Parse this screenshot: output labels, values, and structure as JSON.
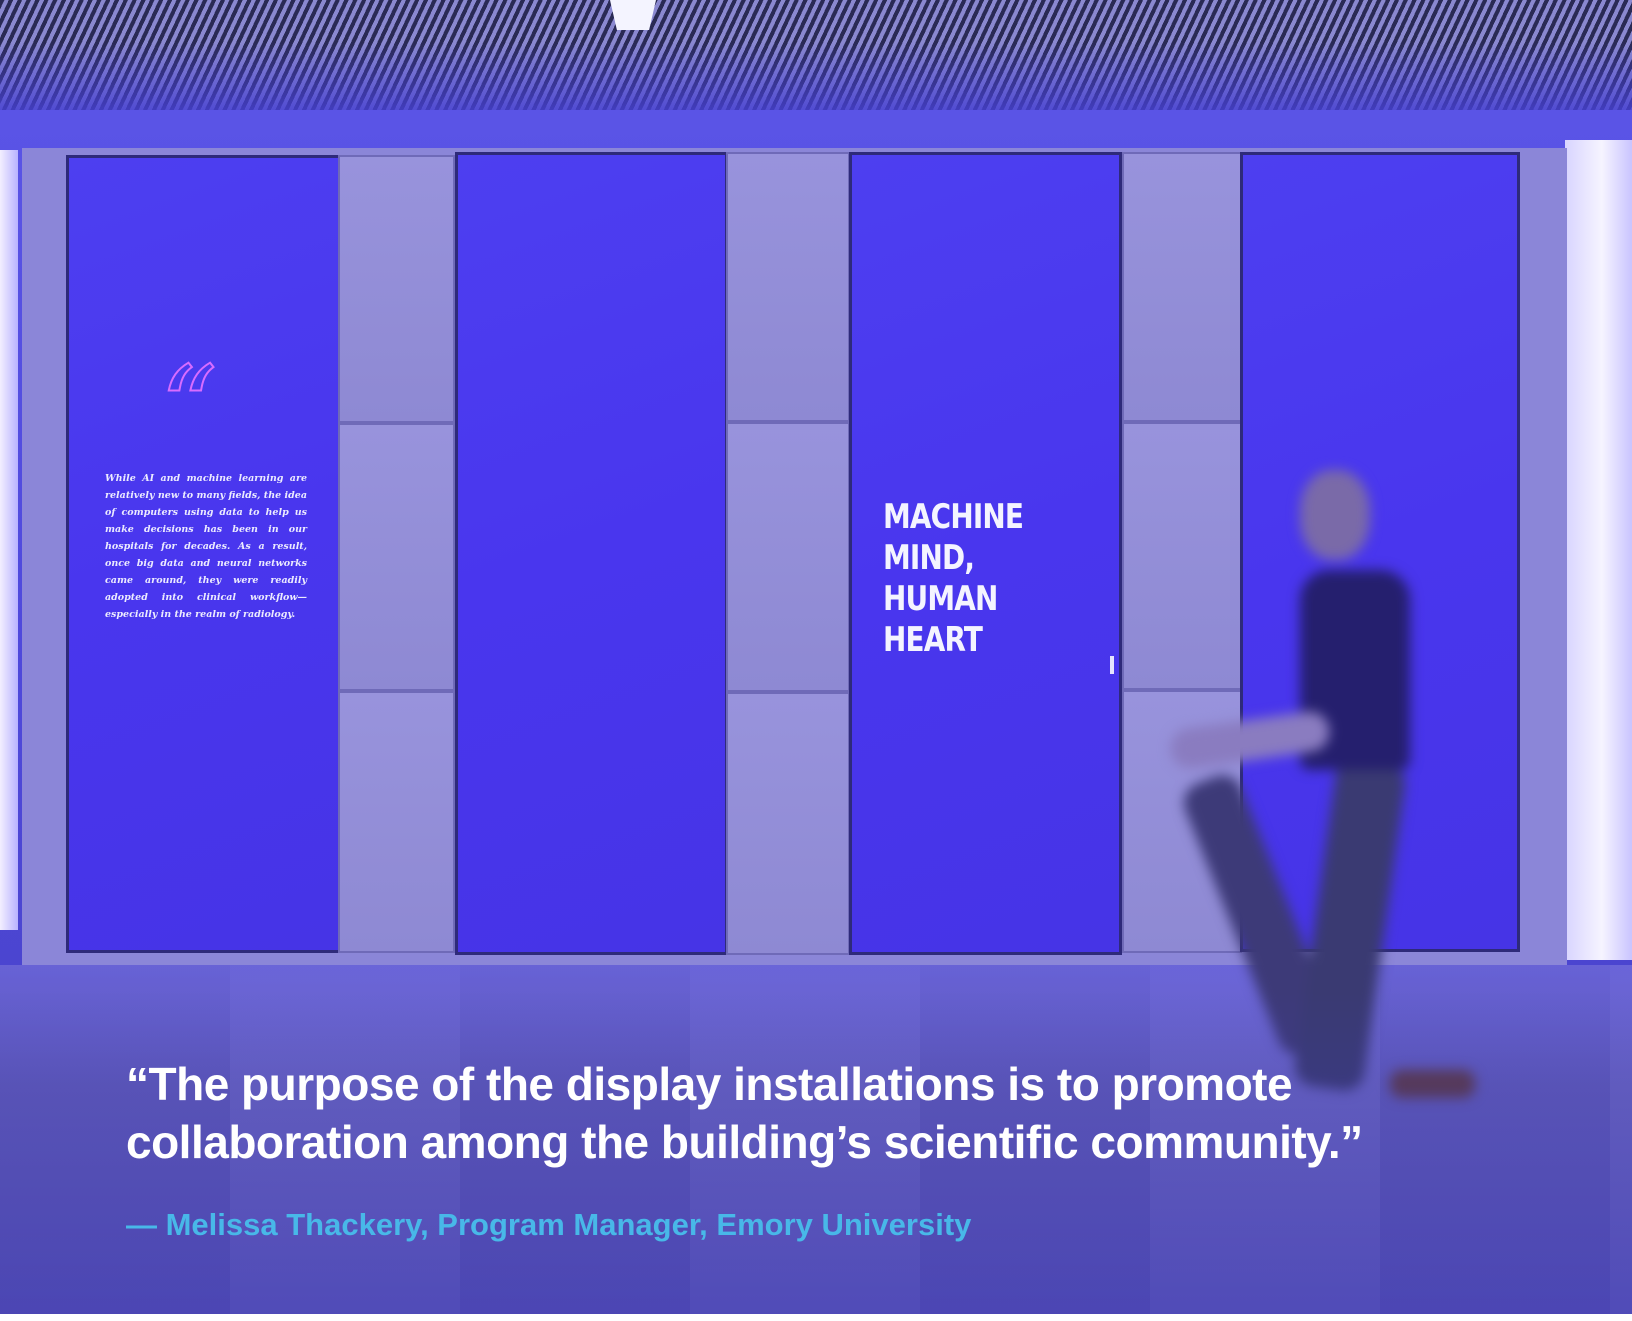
{
  "scene": {
    "screen_left": {
      "quote_glyph": "“",
      "body_text": "While AI and machine learning are relatively new to many fields, the idea of computers using data to help us make decisions has been in our hospitals for decades. As a result, once big data and neural networks came around, they were readily adopted into clinical workflow—especially in the realm of radiology."
    },
    "screen_center": {
      "title": "MACHINE MIND, HUMAN HEART"
    }
  },
  "caption": {
    "quote": "“The purpose of the display installations is to promote collaboration among the building’s scientific community.”",
    "attribution": "— Melissa Thackery, Program Manager, Emory University"
  },
  "colors": {
    "screen_blue": "#4a3cee",
    "accent_pink": "#d86cff",
    "attribution_cyan": "#48b8e8"
  }
}
